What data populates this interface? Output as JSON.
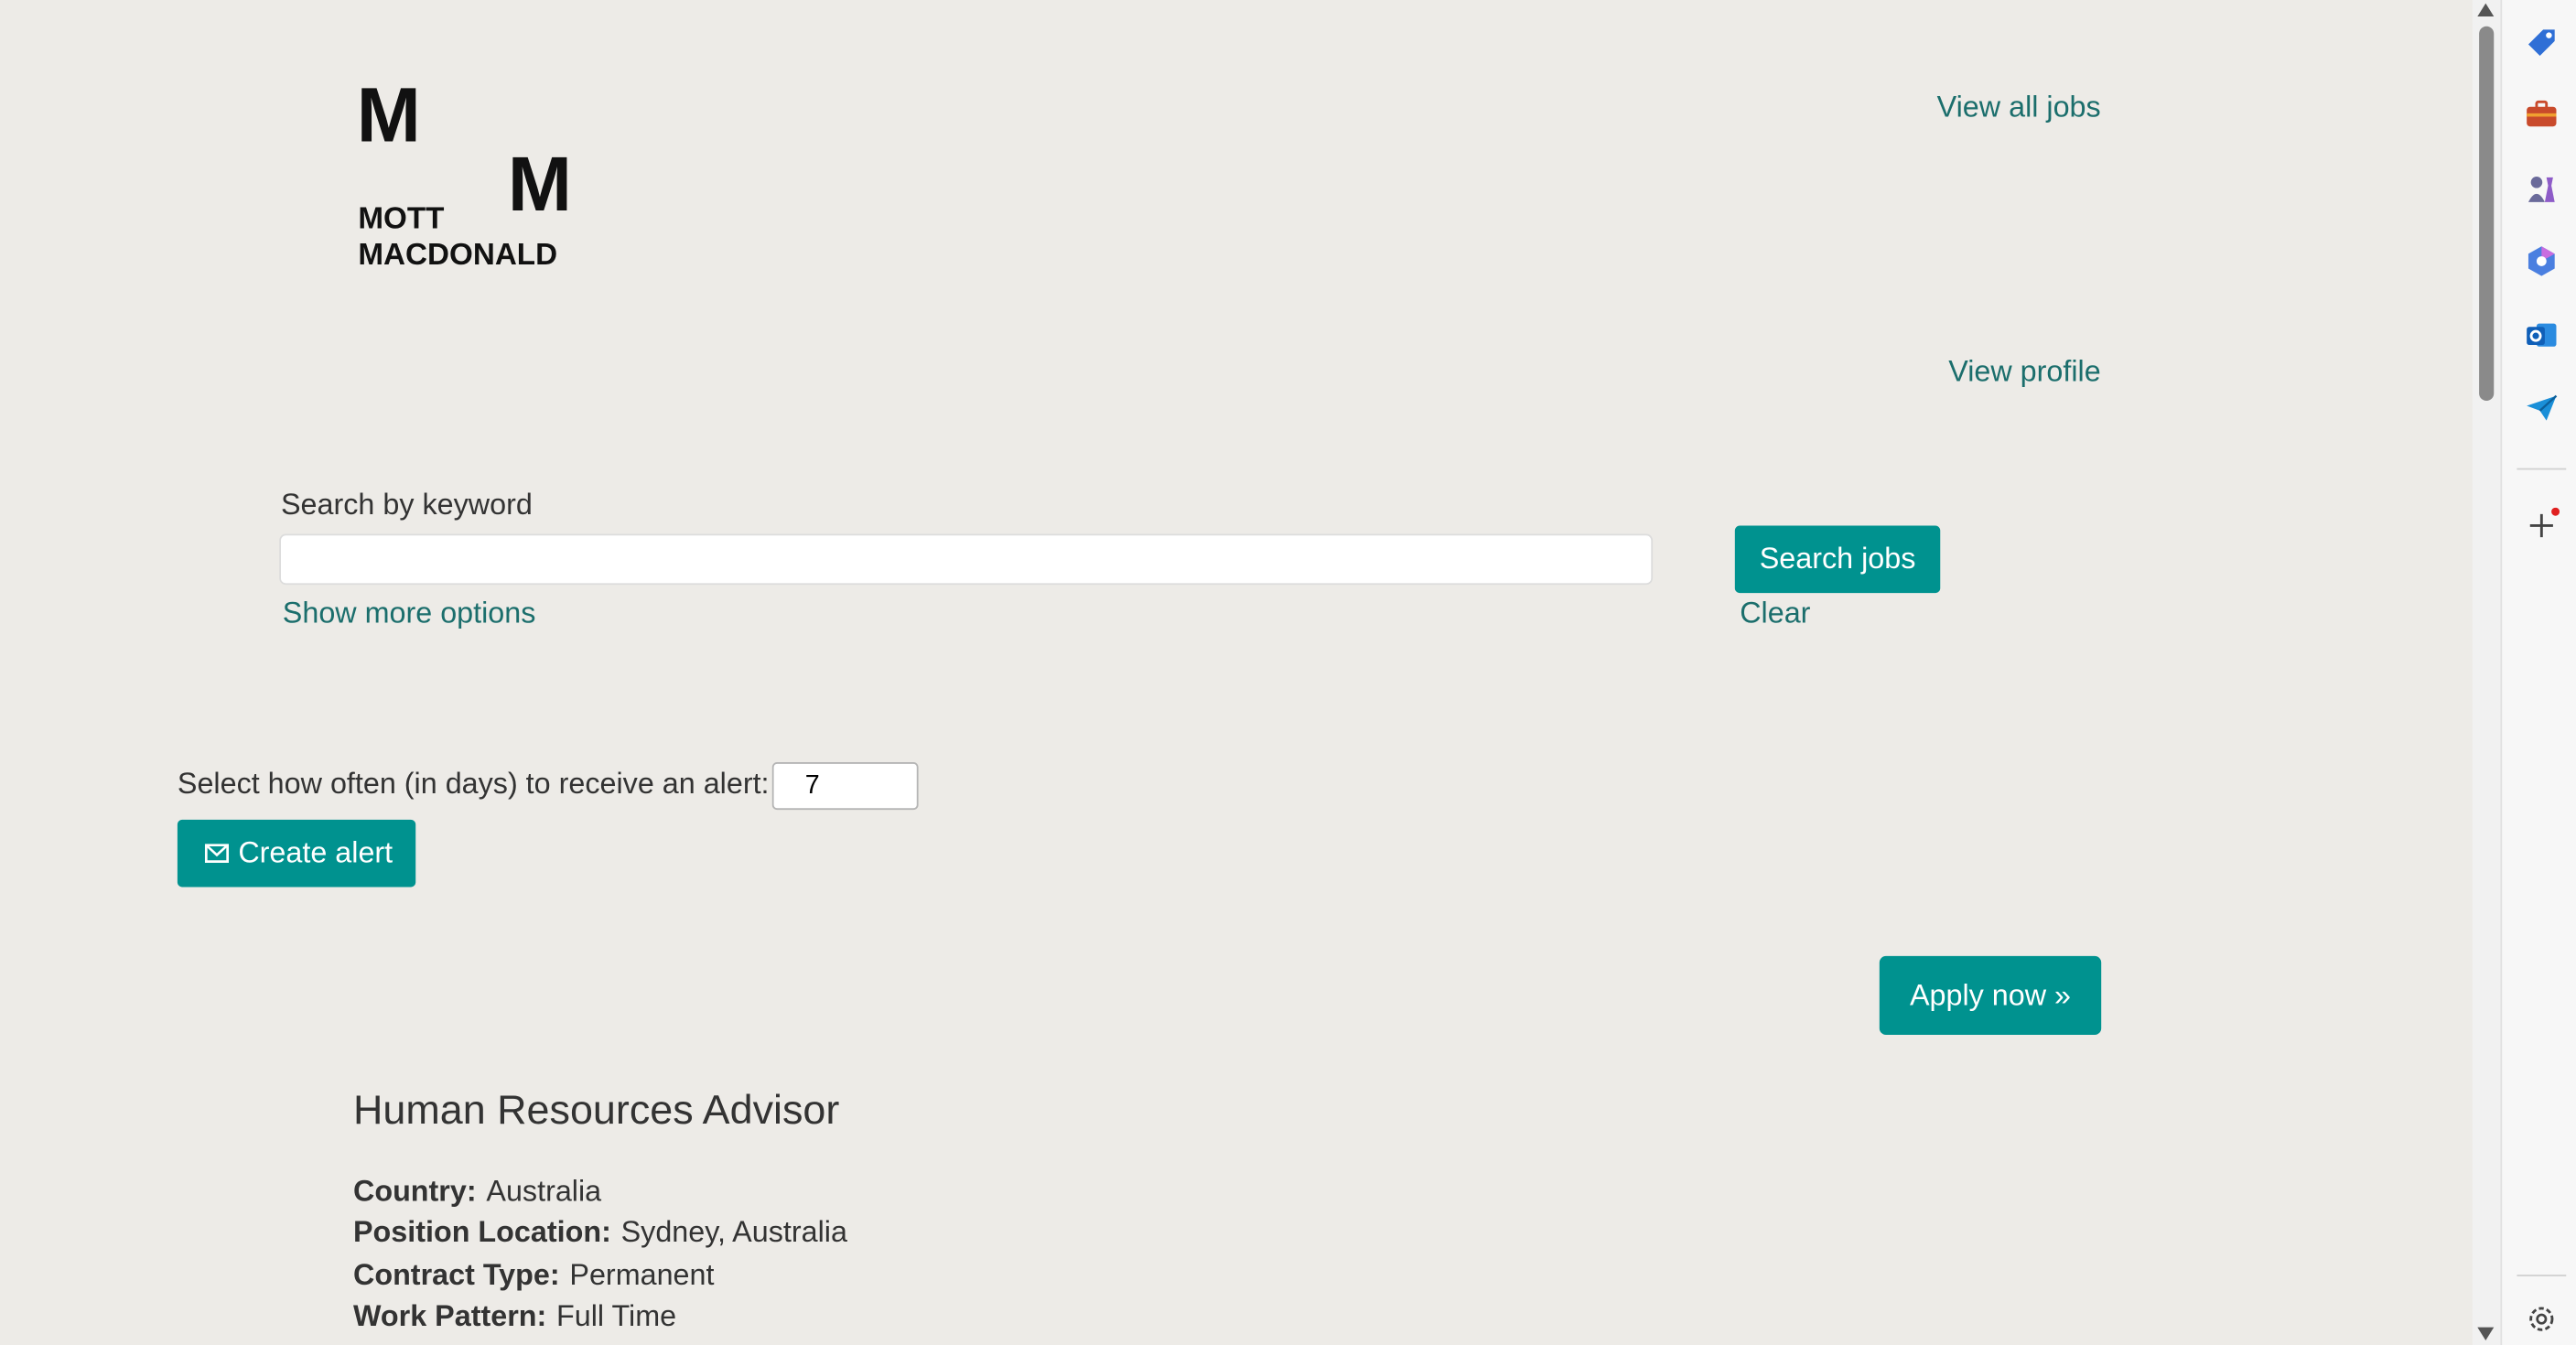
{
  "brand": {
    "logo_letter_top": "M",
    "logo_letter_right": "M",
    "logo_line1": "MOTT",
    "logo_line2": "MACDONALD"
  },
  "header": {
    "view_all_jobs": "View all jobs",
    "view_profile": "View profile"
  },
  "search": {
    "label": "Search by keyword",
    "value": "",
    "placeholder": "",
    "button": "Search jobs",
    "more_options": "Show more options",
    "clear": "Clear"
  },
  "alert": {
    "label": "Select how often (in days) to receive an alert:",
    "days_value": "7",
    "create_button": "Create alert"
  },
  "apply": {
    "button": "Apply now »"
  },
  "job": {
    "title": "Human Resources Advisor",
    "details": [
      {
        "label": "Country:",
        "value": "Australia"
      },
      {
        "label": "Position Location:",
        "value": "Sydney, Australia"
      },
      {
        "label": "Contract Type:",
        "value": "Permanent"
      },
      {
        "label": "Work Pattern:",
        "value": "Full Time"
      }
    ]
  },
  "colors": {
    "accent": "#00928f",
    "link": "#1b6e6c",
    "background": "#edebe7"
  },
  "sidebar": {
    "icons": [
      "tag-icon",
      "briefcase-icon",
      "chess-icon",
      "copilot-icon",
      "outlook-icon",
      "send-icon",
      "add-icon",
      "settings-icon"
    ]
  }
}
